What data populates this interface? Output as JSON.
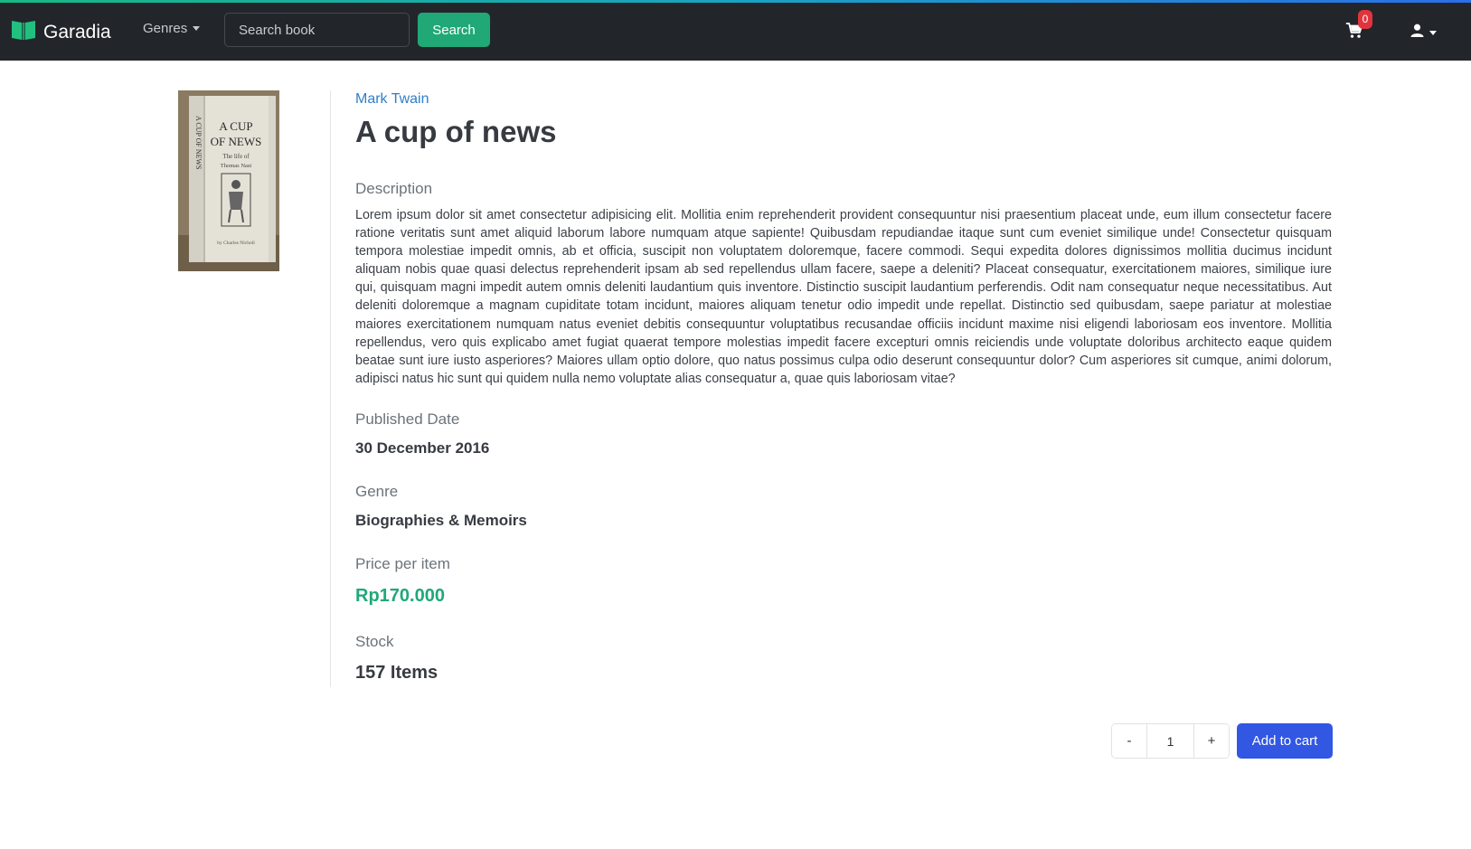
{
  "header": {
    "brand": "Garadia",
    "genres_label": "Genres",
    "search_placeholder": "Search book",
    "search_button": "Search",
    "cart_count": "0"
  },
  "book": {
    "author": "Mark Twain",
    "title": "A cup of news",
    "cover_text": {
      "title_line1": "A CUP",
      "title_line2": "OF NEWS",
      "subtitle_line1": "The life of",
      "subtitle_line2": "Thomas Nast",
      "spine": "A CUP OF NEWS",
      "byline": "by Charles Nicholl"
    },
    "description_label": "Description",
    "description": "Lorem ipsum dolor sit amet consectetur adipisicing elit. Mollitia enim reprehenderit provident consequuntur nisi praesentium placeat unde, eum illum consectetur facere ratione veritatis sunt amet aliquid laborum labore numquam atque sapiente! Quibusdam repudiandae itaque sunt cum eveniet similique unde! Consectetur quisquam tempora molestiae impedit omnis, ab et officia, suscipit non voluptatem doloremque, facere commodi. Sequi expedita dolores dignissimos mollitia ducimus incidunt aliquam nobis quae quasi delectus reprehenderit ipsam ab sed repellendus ullam facere, saepe a deleniti? Placeat consequatur, exercitationem maiores, similique iure qui, quisquam magni impedit autem omnis deleniti laudantium quis inventore. Distinctio suscipit laudantium perferendis. Odit nam consequatur neque necessitatibus. Aut deleniti doloremque a magnam cupiditate totam incidunt, maiores aliquam tenetur odio impedit unde repellat. Distinctio sed quibusdam, saepe pariatur at molestiae maiores exercitationem numquam natus eveniet debitis consequuntur voluptatibus recusandae officiis incidunt maxime nisi eligendi laboriosam eos inventore. Mollitia repellendus, vero quis explicabo amet fugiat quaerat tempore molestias impedit facere excepturi omnis reiciendis unde voluptate doloribus architecto eaque quidem beatae sunt iure iusto asperiores? Maiores ullam optio dolore, quo natus possimus culpa odio deserunt consequuntur dolor? Cum asperiores sit cumque, animi dolorum, adipisci natus hic sunt qui quidem nulla nemo voluptate alias consequatur a, quae quis laboriosam vitae?",
    "published_label": "Published Date",
    "published_date": "30 December 2016",
    "genre_label": "Genre",
    "genre": "Biographies & Memoirs",
    "price_label": "Price per item",
    "price": "Rp170.000",
    "stock_label": "Stock",
    "stock": "157 Items"
  },
  "purchase": {
    "minus": "-",
    "quantity": "1",
    "plus": "+",
    "add_to_cart": "Add to cart"
  },
  "colors": {
    "navbar": "#22262b",
    "accent_green": "#20a876",
    "price_green": "#21a878",
    "primary_blue": "#3257e3",
    "badge_red": "#e0343d",
    "link_blue": "#2f7fc9"
  },
  "icons": {
    "brand": "book-open-icon",
    "cart": "shopping-cart-icon",
    "user": "user-icon"
  }
}
